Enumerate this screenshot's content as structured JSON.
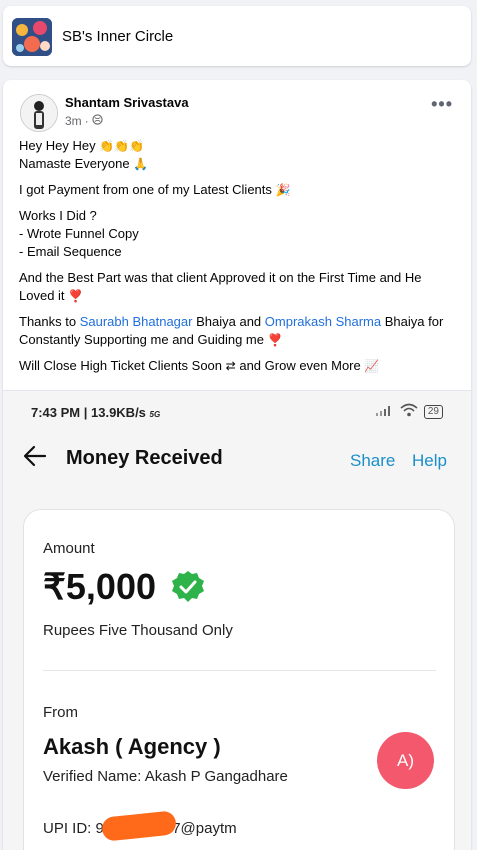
{
  "group": {
    "name": "SB's Inner Circle"
  },
  "post": {
    "author": "Shantam Srivastava",
    "time": "3m",
    "more_label": "•••",
    "line1": "Hey Hey Hey",
    "line2": "Namaste Everyone",
    "line3": "I got Payment from one of my Latest Clients",
    "works_title": "Works I Did ?",
    "work1": "- Wrote Funnel Copy",
    "work2": "- Email Sequence",
    "best_part": "And the Best Part was that client Approved it on the First Time and He Loved it",
    "thanks_prefix": "Thanks to",
    "mention1": "Saurabh Bhatnagar",
    "thanks_mid": "Bhaiya and",
    "mention2": "Omprakash Sharma",
    "thanks_suffix": "Bhaiya for Constantly Supporting me and Guiding me",
    "closing_a": "Will Close High Ticket Clients Soon",
    "closing_b": "and Grow even More"
  },
  "screenshot": {
    "status_time": "7:43 PM | 13.9KB/s",
    "status_net": "5G",
    "battery": "29",
    "title": "Money Received",
    "share": "Share",
    "help": "Help",
    "amount_label": "Amount",
    "amount": "₹5,000",
    "amount_words": "Rupees Five Thousand Only",
    "from_label": "From",
    "from_name": "Akash ( Agency )",
    "verified_name": "Verified Name: Akash P Gangadhare",
    "upi_prefix": "UPI ID: 9",
    "upi_suffix": "87@paytm",
    "avatar_initials": "A)"
  },
  "colors": {
    "link": "#216fdb",
    "paytm_blue": "#1a8fc9",
    "badge": "#f3586c",
    "verified": "#2db34a"
  }
}
